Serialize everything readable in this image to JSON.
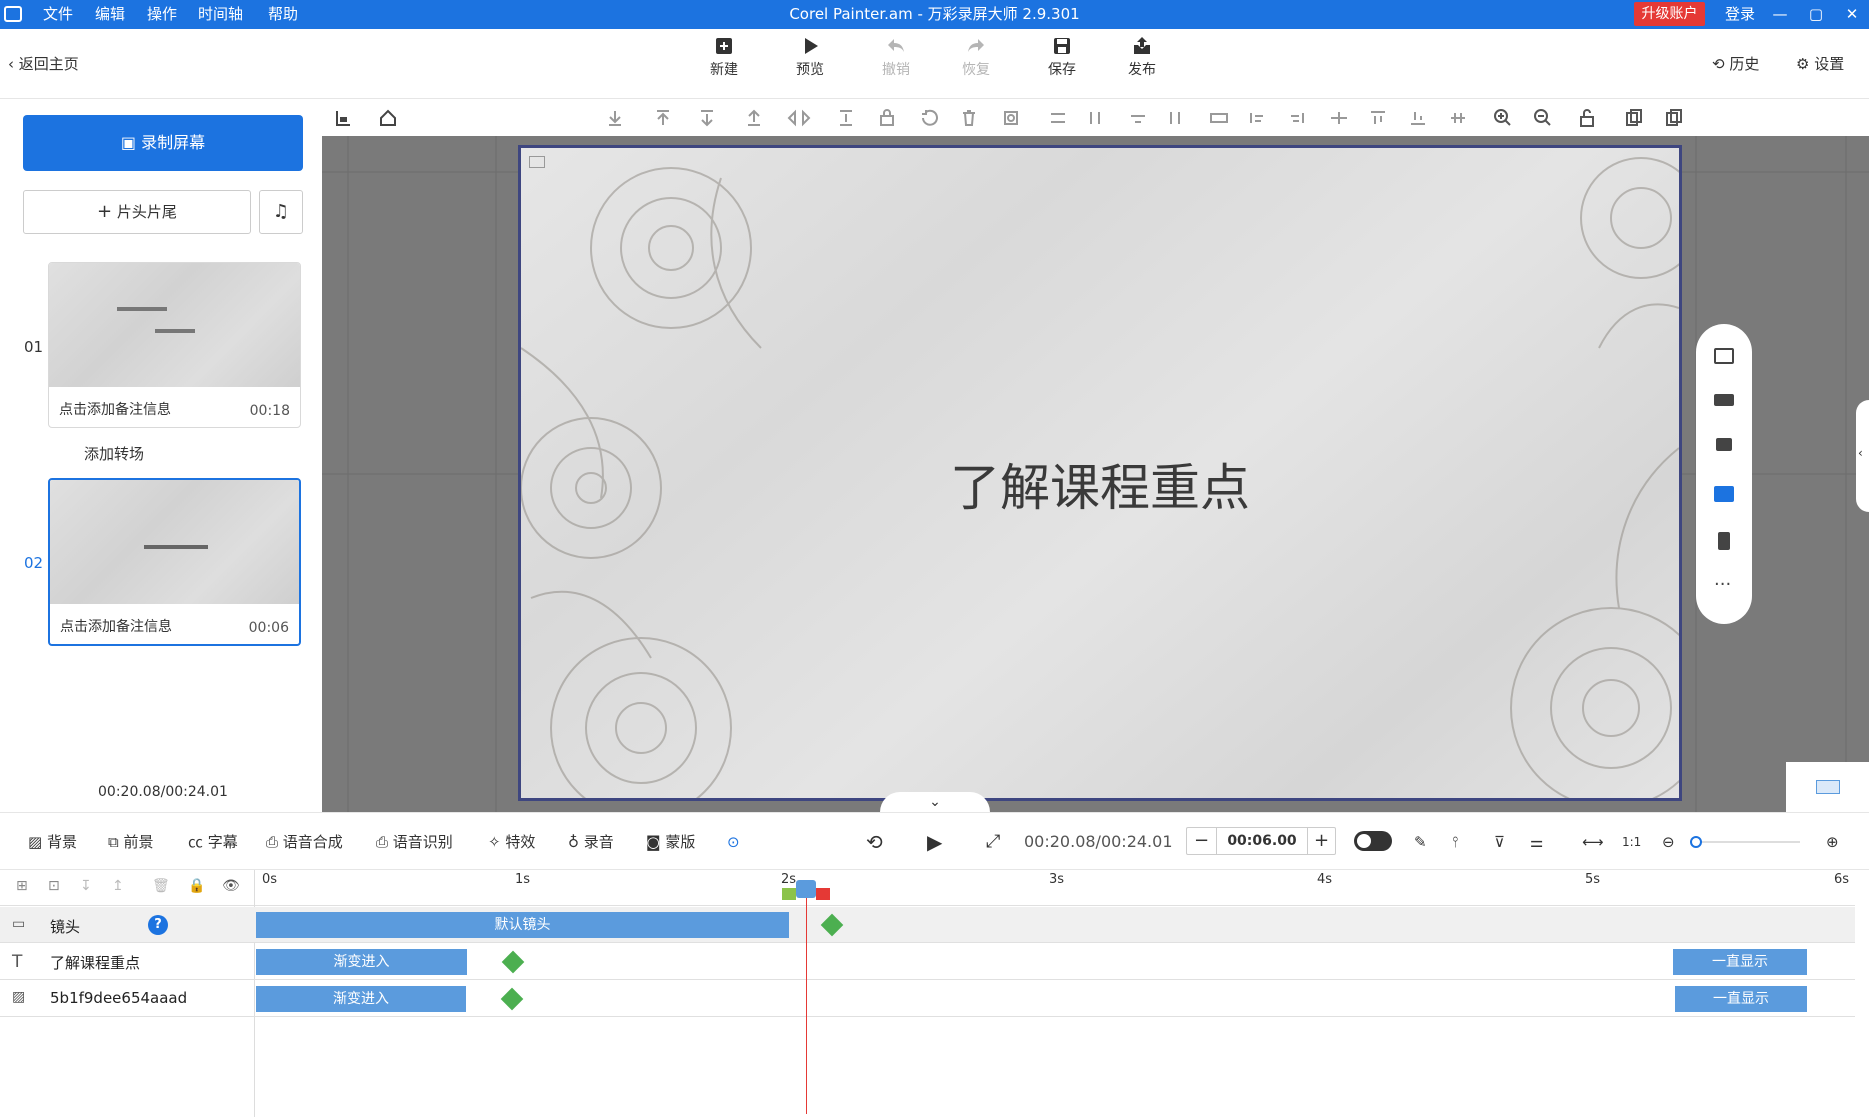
{
  "titlebar": {
    "menu": [
      "文件",
      "编辑",
      "操作",
      "时间轴",
      "帮助"
    ],
    "title": "Corel Painter.am - 万彩录屏大师 2.9.301",
    "upgrade": "升级账户",
    "login": "登录"
  },
  "topbar": {
    "back": "返回主页",
    "buttons": [
      {
        "label": "新建",
        "icon": "new-icon",
        "enabled": true
      },
      {
        "label": "预览",
        "icon": "play-icon",
        "enabled": true
      },
      {
        "label": "撤销",
        "icon": "undo-icon",
        "enabled": false
      },
      {
        "label": "恢复",
        "icon": "redo-icon",
        "enabled": false
      },
      {
        "label": "保存",
        "icon": "save-icon",
        "enabled": true
      },
      {
        "label": "发布",
        "icon": "publish-icon",
        "enabled": true
      }
    ],
    "history": "历史",
    "settings": "设置"
  },
  "left": {
    "record": "录制屏幕",
    "intro_outro": "片头片尾",
    "scenes": [
      {
        "index": "01",
        "caption": "点击添加备注信息",
        "duration": "00:18",
        "selected": false
      },
      {
        "index": "02",
        "caption": "点击添加备注信息",
        "duration": "00:06",
        "selected": true
      }
    ],
    "add_transition": "添加转场",
    "time": "00:20.08/00:24.01"
  },
  "canvas": {
    "text": "了解课程重点"
  },
  "bottom_tools": {
    "items": [
      "背景",
      "前景",
      "字幕",
      "语音合成",
      "语音识别",
      "特效",
      "录音",
      "蒙版"
    ],
    "time": "00:20.08/00:24.01",
    "duration": "00:06.00"
  },
  "timeline": {
    "ticks": [
      "0s",
      "1s",
      "2s",
      "3s",
      "4s",
      "5s",
      "6s"
    ],
    "tracks": [
      {
        "name": "镜头",
        "clips": [
          "默认镜头"
        ]
      },
      {
        "name": "了解课程重点",
        "clips": [
          "渐变进入",
          "一直显示"
        ]
      },
      {
        "name": "5b1f9dee654aaad",
        "clips": [
          "渐变进入",
          "一直显示"
        ]
      }
    ]
  },
  "colors": {
    "accent": "#1c73e0",
    "upgrade": "#e53935",
    "clip": "#5b9bdd",
    "playhead": "#e53935"
  }
}
